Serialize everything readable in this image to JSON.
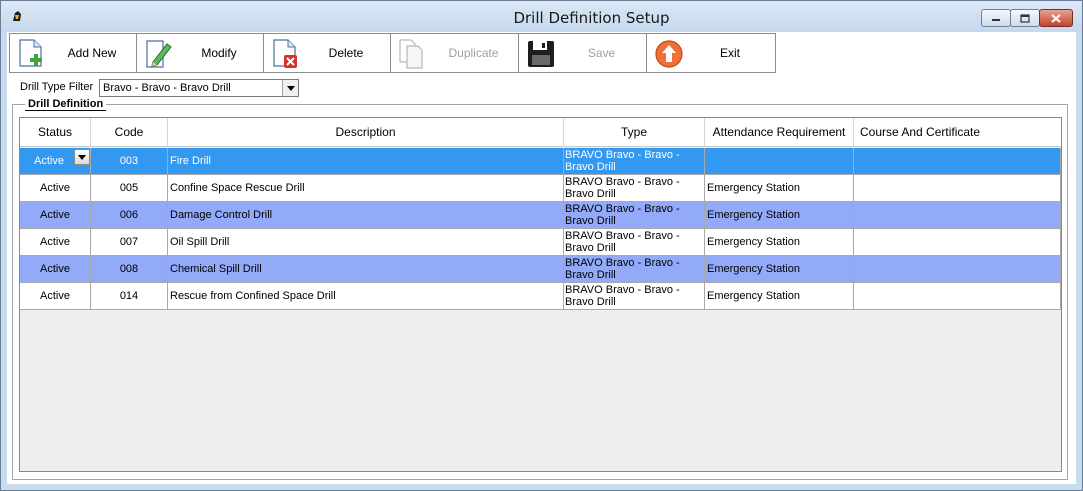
{
  "window": {
    "title": "Drill Definition Setup",
    "icon": "app-icon"
  },
  "toolbar": {
    "buttons": [
      {
        "label": "Add New",
        "icon": "add-new-icon",
        "enabled": true
      },
      {
        "label": "Modify",
        "icon": "modify-icon",
        "enabled": true
      },
      {
        "label": "Delete",
        "icon": "delete-icon",
        "enabled": true
      },
      {
        "label": "Duplicate",
        "icon": "duplicate-icon",
        "enabled": false
      },
      {
        "label": "Save",
        "icon": "save-icon",
        "enabled": false
      },
      {
        "label": "Exit",
        "icon": "exit-icon",
        "enabled": true
      }
    ]
  },
  "filter": {
    "label": "Drill Type Filter",
    "value": "Bravo - Bravo - Bravo Drill"
  },
  "group": {
    "title": "Drill Definition"
  },
  "grid": {
    "columns": [
      "Status",
      "Code",
      "Description",
      "Type",
      "Attendance Requirement",
      "Course And Certificate"
    ],
    "rows": [
      {
        "status": "Active",
        "code": "003",
        "description": "Fire Drill",
        "type_line1": "BRAVO Bravo - Bravo -",
        "type_line2": "Bravo Drill",
        "attendance": "",
        "course": "",
        "style": "selected"
      },
      {
        "status": "Active",
        "code": "005",
        "description": "Confine Space Rescue Drill",
        "type_line1": "BRAVO Bravo - Bravo -",
        "type_line2": "Bravo Drill",
        "attendance": "Emergency Station",
        "course": "",
        "style": "white"
      },
      {
        "status": "Active",
        "code": "006",
        "description": "Damage Control Drill",
        "type_line1": "BRAVO Bravo - Bravo -",
        "type_line2": "Bravo Drill",
        "attendance": "Emergency Station",
        "course": "",
        "style": "alt"
      },
      {
        "status": "Active",
        "code": "007",
        "description": "Oil Spill Drill",
        "type_line1": "BRAVO Bravo - Bravo -",
        "type_line2": "Bravo Drill",
        "attendance": "Emergency Station",
        "course": "",
        "style": "white"
      },
      {
        "status": "Active",
        "code": "008",
        "description": "Chemical Spill Drill",
        "type_line1": "BRAVO Bravo - Bravo -",
        "type_line2": "Bravo Drill",
        "attendance": "Emergency Station",
        "course": "",
        "style": "alt"
      },
      {
        "status": "Active",
        "code": "014",
        "description": "Rescue from Confined Space Drill",
        "type_line1": "BRAVO Bravo - Bravo -",
        "type_line2": "Bravo Drill",
        "attendance": "Emergency Station",
        "course": "",
        "style": "white"
      }
    ]
  },
  "colors": {
    "selected_row": "#3398f0",
    "alt_row": "#93aaf9",
    "window_frame": "#c9dbee",
    "exit_icon": "#f0703c",
    "delete_icon": "#d9302a",
    "add_icon": "#3aa83a"
  }
}
